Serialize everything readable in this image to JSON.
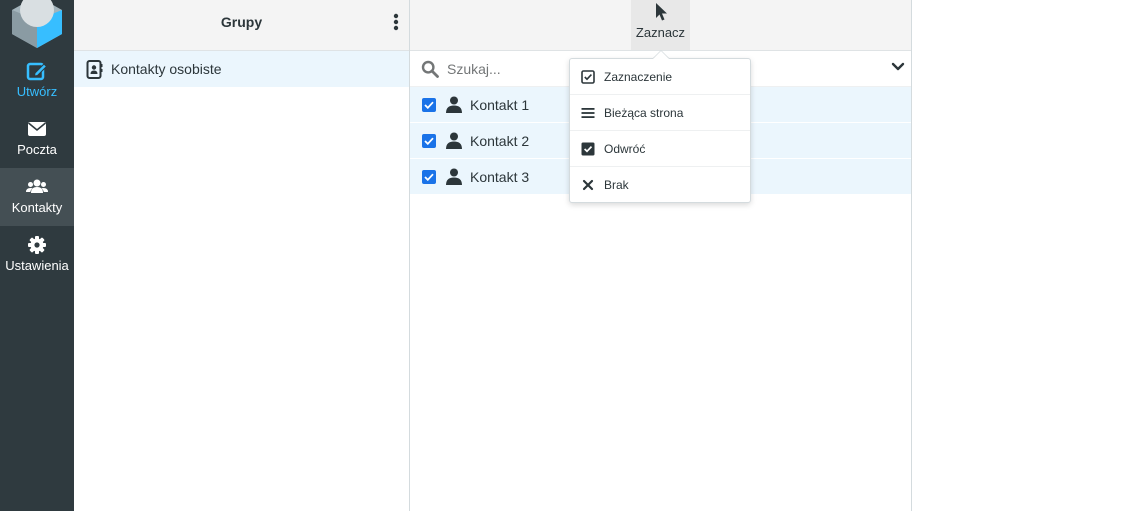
{
  "nav": {
    "items": [
      {
        "label": "Utwórz",
        "icon": "compose-icon"
      },
      {
        "label": "Poczta",
        "icon": "envelope-icon"
      },
      {
        "label": "Kontakty",
        "icon": "users-icon"
      },
      {
        "label": "Ustawienia",
        "icon": "gear-icon"
      }
    ],
    "accent_color": "#37beff",
    "background": "#2f3a3f"
  },
  "groups": {
    "title": "Grupy",
    "items": [
      {
        "label": "Kontakty osobiste",
        "icon": "address-book-icon"
      }
    ]
  },
  "contacts": {
    "toolbar": {
      "select_label": "Zaznacz",
      "select_icon": "pointer-icon"
    },
    "search": {
      "placeholder": "Szukaj...",
      "value": ""
    },
    "rows": [
      {
        "name": "Kontakt 1",
        "checked": true
      },
      {
        "name": "Kontakt 2",
        "checked": true
      },
      {
        "name": "Kontakt 3",
        "checked": true
      }
    ]
  },
  "select_menu": {
    "items": [
      {
        "label": "Zaznaczenie",
        "icon": "checkbox-outline-icon"
      },
      {
        "label": "Bieżąca strona",
        "icon": "list-icon"
      },
      {
        "label": "Odwróć",
        "icon": "checkbox-filled-icon"
      },
      {
        "label": "Brak",
        "icon": "close-icon"
      }
    ]
  }
}
